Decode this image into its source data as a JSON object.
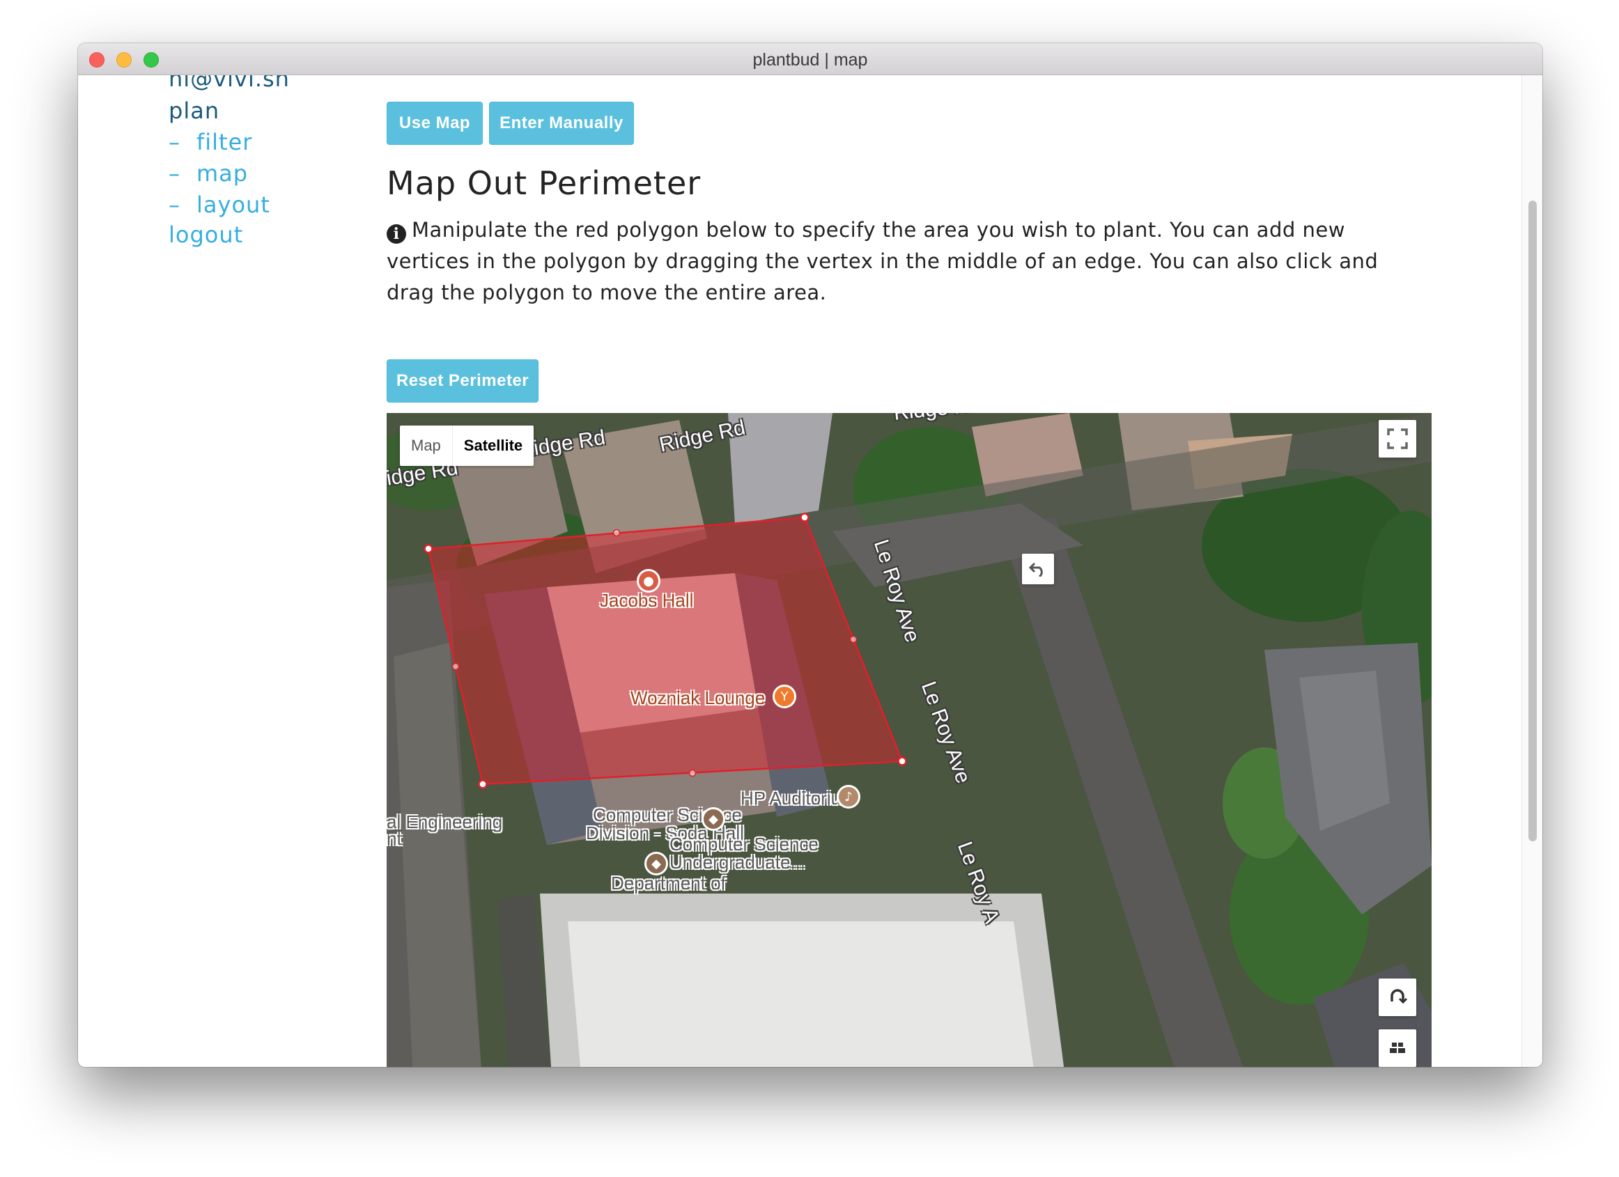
{
  "window": {
    "title": "plantbud | map"
  },
  "sidebar": {
    "email": "hi@vivi.sh",
    "plan_label": "plan",
    "items": [
      {
        "dash": "–",
        "label": "filter"
      },
      {
        "dash": "–",
        "label": "map"
      },
      {
        "dash": "–",
        "label": "layout"
      }
    ],
    "logout_label": "logout"
  },
  "toolbar": {
    "use_map_label": "Use Map",
    "enter_manually_label": "Enter Manually"
  },
  "main": {
    "heading": "Map Out Perimeter",
    "instructions": "Manipulate the red polygon below to specify the area you wish to plant. You can add new vertices in the polygon by dragging the vertex in the middle of an edge. You can also click and drag the polygon to move the entire area.",
    "reset_label": "Reset Perimeter"
  },
  "map": {
    "type_options": [
      "Map",
      "Satellite"
    ],
    "selected_type": "Satellite",
    "street_labels": [
      "Ridge Rd",
      "Ridge Rd",
      "idge Rd",
      "Ridge Rd",
      "Le Roy Ave",
      "Le Roy Ave",
      "Le Roy A"
    ],
    "poi_labels": {
      "jacobs_hall": "Jacobs Hall",
      "wozniak_lounge": "Wozniak Lounge",
      "hp_auditorium": "HP Auditorium",
      "soda_hall_line1": "Computer Science",
      "soda_hall_line2": "Division - Soda Hall",
      "undergrad_line1": "Computer Science",
      "undergrad_line2": "Undergraduate...",
      "department": "Department of",
      "engineering_line1": "al Engineering",
      "engineering_line2": "nt"
    },
    "polygon_color": "#e0202a",
    "icons": [
      "fullscreen-icon",
      "rotate-icon",
      "tilt-icon",
      "pegman-icon",
      "undo-icon"
    ]
  }
}
